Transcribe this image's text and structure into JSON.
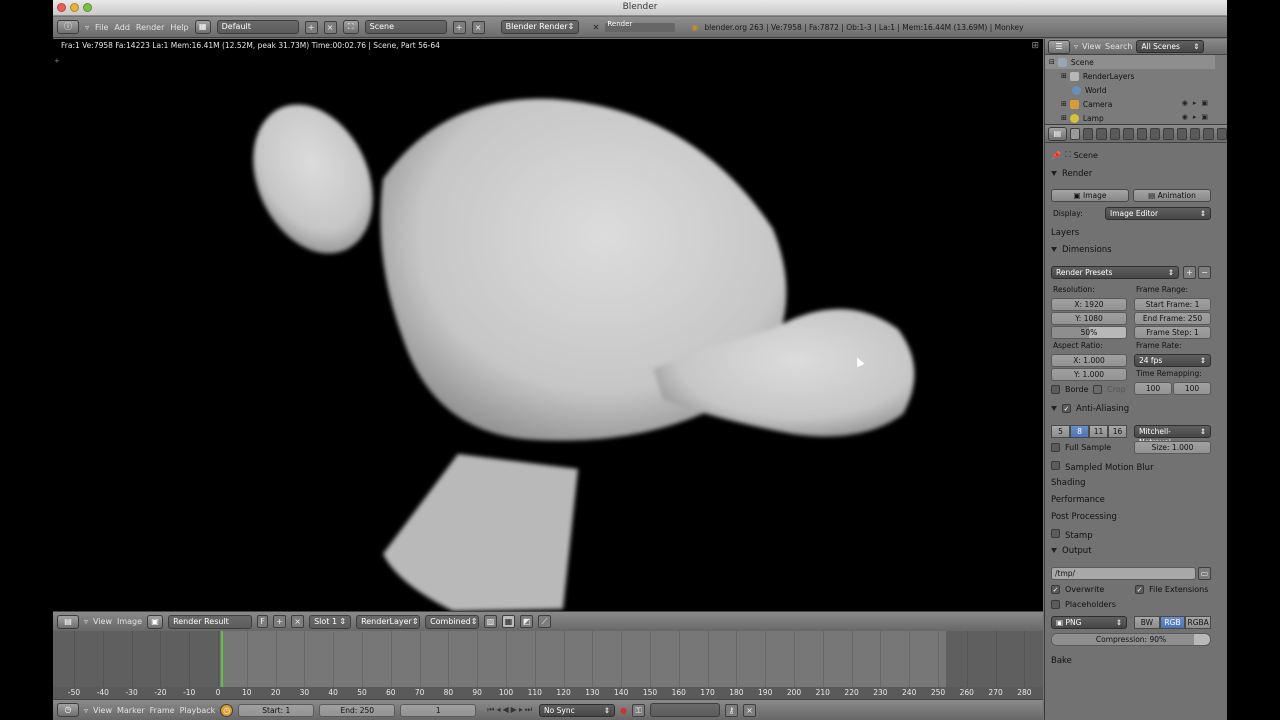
{
  "window": {
    "title": "Blender"
  },
  "infobar": {
    "menus": [
      "File",
      "Add",
      "Render",
      "Help"
    ],
    "layout": "Default",
    "scene": "Scene",
    "engine": "Blender Render",
    "render_label": "Render",
    "stats": "blender.org 263 | Ve:7958 | Fa:7872 | Ob:1-3 | La:1 | Mem:16.44M (13.69M) | Monkey"
  },
  "viewport": {
    "render_stats": "Fra:1  Ve:7958 Fa:14223 La:1 Mem:16.41M (12.52M, peak 31.73M) Time:00:02.76 | Scene, Part 56-64"
  },
  "image_header": {
    "menus": [
      "View",
      "Image"
    ],
    "image": "Render Result",
    "fake_user": "F",
    "slot": "Slot 1",
    "layer": "RenderLayer",
    "pass": "Combined"
  },
  "timeline": {
    "ticks": [
      -50,
      -40,
      -30,
      -20,
      -10,
      0,
      10,
      20,
      30,
      40,
      50,
      60,
      70,
      80,
      90,
      100,
      110,
      120,
      130,
      140,
      150,
      160,
      170,
      180,
      190,
      200,
      210,
      220,
      230,
      240,
      250,
      260,
      270,
      280
    ],
    "menus": [
      "View",
      "Marker",
      "Frame",
      "Playback"
    ],
    "start": "Start: 1",
    "end": "End: 250",
    "current": "1",
    "sync": "No Sync"
  },
  "outliner": {
    "menus": [
      "View",
      "Search"
    ],
    "filter": "All Scenes",
    "items": [
      {
        "label": "Scene",
        "color": "#9aa6b6"
      },
      {
        "label": "RenderLayers",
        "color": "#b7b7b7"
      },
      {
        "label": "World",
        "color": "#6c8fb8"
      },
      {
        "label": "Camera",
        "color": "#d69c3a"
      },
      {
        "label": "Lamp",
        "color": "#d6c23a"
      }
    ]
  },
  "properties": {
    "context": "Scene",
    "render_panel": "Render",
    "image_btn": "Image",
    "animation_btn": "Animation",
    "display_label": "Display:",
    "display_value": "Image Editor",
    "layers_panel": "Layers",
    "dimensions_panel": "Dimensions",
    "render_presets": "Render Presets",
    "resolution_label": "Resolution:",
    "res_x": "X: 1920",
    "res_y": "Y: 1080",
    "res_pct": "50%",
    "res_pct_value": 50,
    "frame_range_label": "Frame Range:",
    "start_frame": "Start Frame: 1",
    "end_frame": "End Frame: 250",
    "frame_step": "Frame Step: 1",
    "aspect_label": "Aspect Ratio:",
    "aspect_x": "X: 1.000",
    "aspect_y": "Y: 1.000",
    "frame_rate_label": "Frame Rate:",
    "fps": "24 fps",
    "time_remap_label": "Time Remapping:",
    "remap_old": "100",
    "remap_new": "100",
    "border_label": "Borde",
    "crop_label": "Crop",
    "aa_panel": "Anti-Aliasing",
    "aa_samples": [
      "5",
      "8",
      "11",
      "16"
    ],
    "aa_selected": "8",
    "aa_filter": "Mitchell-Netraval",
    "full_sample": "Full Sample",
    "size": "Size: 1.000",
    "motion_blur_panel": "Sampled Motion Blur",
    "shading_panel": "Shading",
    "performance_panel": "Performance",
    "post_panel": "Post Processing",
    "stamp_panel": "Stamp",
    "output_panel": "Output",
    "output_path": "/tmp/",
    "overwrite": "Overwrite",
    "file_ext": "File Extensions",
    "placeholders": "Placeholders",
    "format": "PNG",
    "color_modes": [
      "BW",
      "RGB",
      "RGBA"
    ],
    "color_selected": "RGB",
    "compression": "Compression: 90%",
    "compression_value": 90,
    "bake_panel": "Bake"
  },
  "colors": {
    "accent": "#5680c2",
    "current_frame": "#60c040",
    "close": "#ec5f56",
    "minimize": "#e0b43d",
    "zoom": "#79c04a"
  }
}
